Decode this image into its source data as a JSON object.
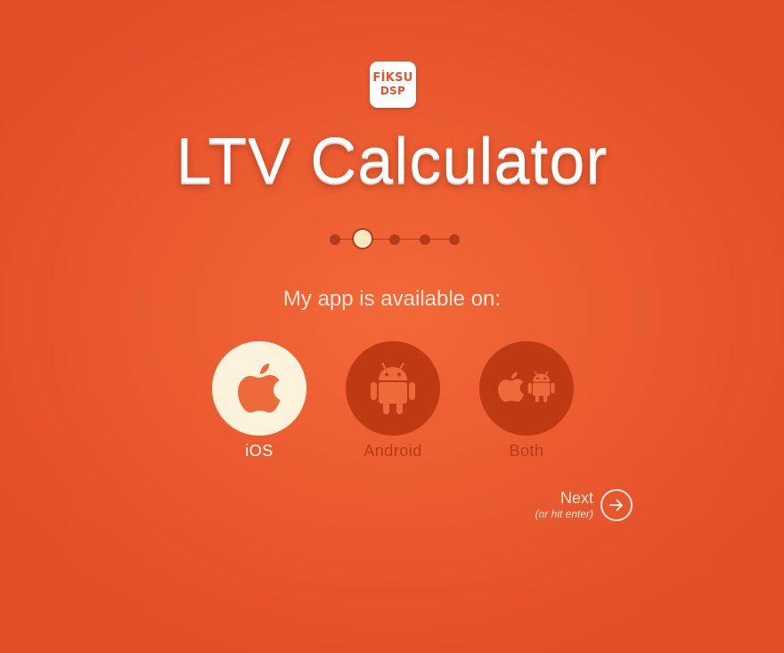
{
  "logo": {
    "line1": "FİKSU",
    "line2": "DSP"
  },
  "title": "LTV Calculator",
  "progress": {
    "total_steps": 5,
    "current_step": 2
  },
  "question": "My app is available on:",
  "options": [
    {
      "label": "iOS",
      "icon": "apple-icon",
      "selected": true
    },
    {
      "label": "Android",
      "icon": "android-icon",
      "selected": false
    },
    {
      "label": "Both",
      "icon": "apple-android-icon",
      "selected": false
    }
  ],
  "next": {
    "label": "Next",
    "hint": "(or hit enter)",
    "icon": "arrow-right-icon"
  },
  "colors": {
    "background": "#ec5c31",
    "unselected_circle": "#bf3a13",
    "selected_circle": "#fdf3dc",
    "icon_orange": "#ee6a3a"
  }
}
